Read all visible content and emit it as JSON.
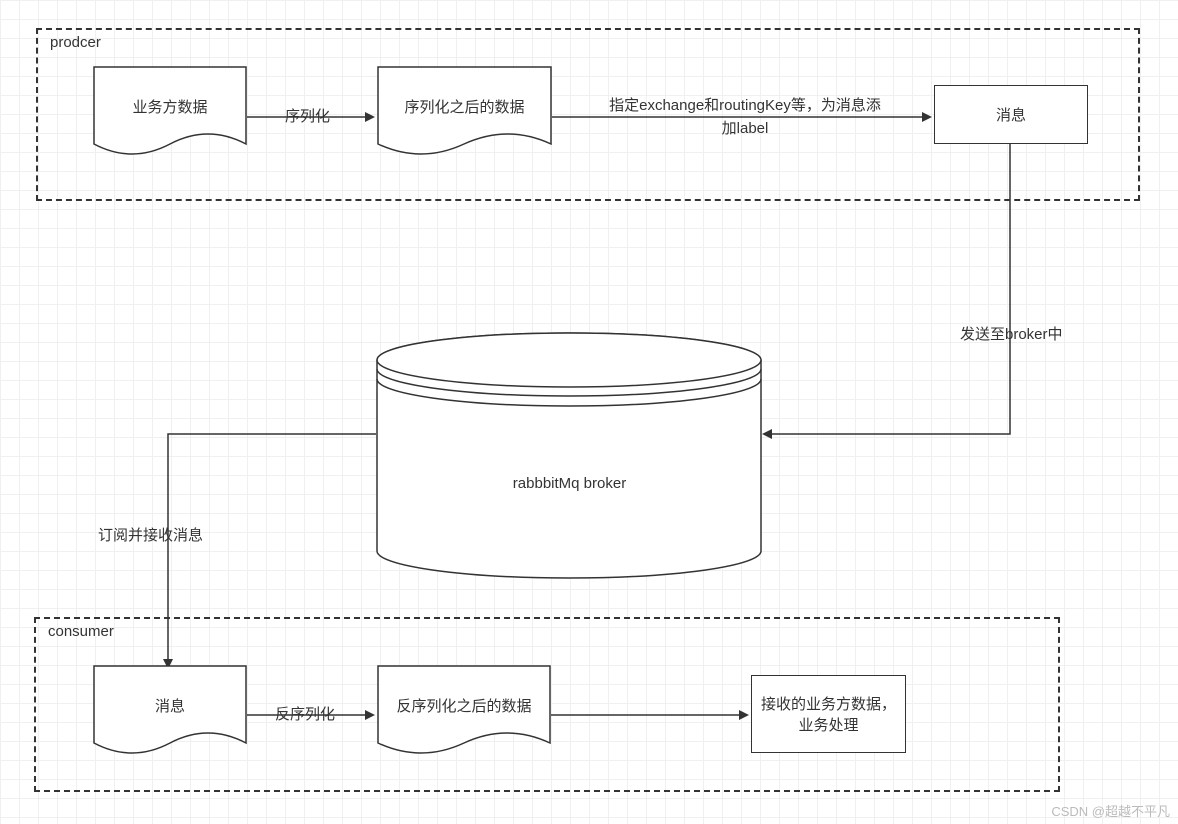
{
  "producer": {
    "label": "prodcer",
    "biz_data": "业务方数据",
    "serialize": "序列化",
    "serialized_data": "序列化之后的数据",
    "route_label": "指定exchange和routingKey等，为消息添加label",
    "message": "消息"
  },
  "broker": {
    "send_label": "发送至broker中",
    "name": "rabbbitMq broker",
    "subscribe_label": "订阅并接收消息"
  },
  "consumer": {
    "label": "consumer",
    "message": "消息",
    "deserialize": "反序列化",
    "deserialized_data": "反序列化之后的数据",
    "receive": "接收的业务方数据，业务处理"
  },
  "watermark": "CSDN @超越不平凡"
}
